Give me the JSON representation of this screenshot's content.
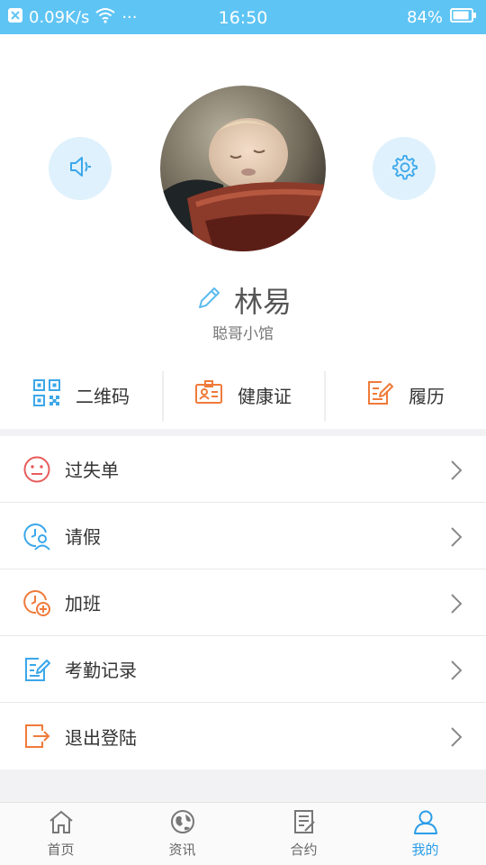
{
  "status_bar": {
    "net_speed": "0.09K/s",
    "dots": "···",
    "time": "16:50",
    "battery": "84%"
  },
  "profile": {
    "name": "林易",
    "subtitle": "聪哥小馆",
    "avatar_alt": "avatar"
  },
  "quick_actions": [
    {
      "label": "二维码",
      "icon": "qr-code-icon"
    },
    {
      "label": "健康证",
      "icon": "id-card-icon"
    },
    {
      "label": "履历",
      "icon": "edit-doc-icon"
    }
  ],
  "menu": [
    {
      "label": "过失单",
      "icon": "face-neutral-icon"
    },
    {
      "label": "请假",
      "icon": "clock-person-icon"
    },
    {
      "label": "加班",
      "icon": "clock-plus-icon"
    },
    {
      "label": "考勤记录",
      "icon": "edit-doc-icon"
    },
    {
      "label": "退出登陆",
      "icon": "logout-icon"
    }
  ],
  "bottom_nav": [
    {
      "label": "首页",
      "icon": "home-icon"
    },
    {
      "label": "资讯",
      "icon": "globe-icon"
    },
    {
      "label": "合约",
      "icon": "contract-icon"
    },
    {
      "label": "我的",
      "icon": "user-icon",
      "active": true
    }
  ],
  "colors": {
    "status_bar": "#5ec4f4",
    "accent_blue": "#2a9de8",
    "accent_orange": "#f07a3a",
    "accent_red": "#e85c5c"
  }
}
